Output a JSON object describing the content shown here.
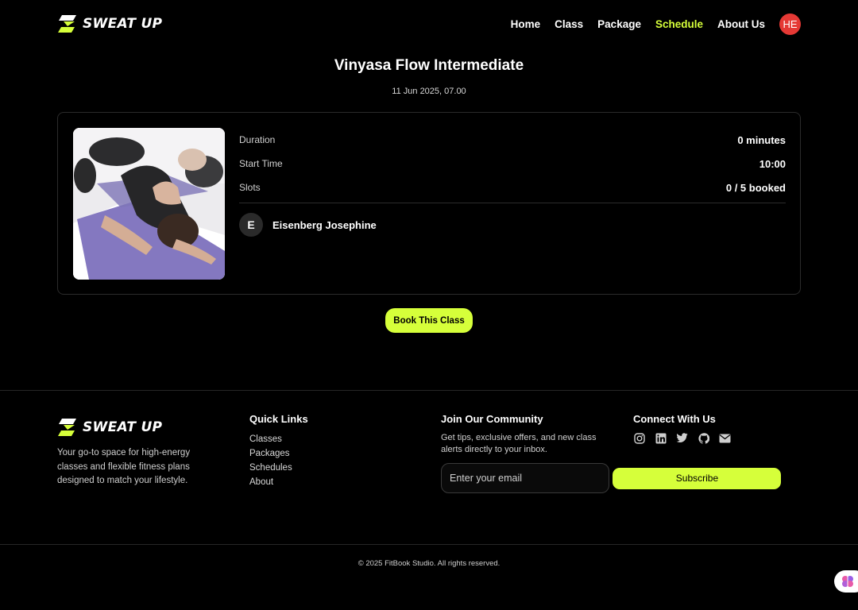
{
  "brand": {
    "name": "SWEAT UP",
    "accent": "#d6ff3a"
  },
  "nav": {
    "items": [
      {
        "label": "Home"
      },
      {
        "label": "Class"
      },
      {
        "label": "Package"
      },
      {
        "label": "Schedule",
        "active": true
      },
      {
        "label": "About Us"
      }
    ],
    "user_initials": "HE",
    "avatar_color": "#e53935"
  },
  "session": {
    "title": "Vinyasa Flow Intermediate",
    "datetime": "11 Jun 2025, 07.00",
    "details": [
      {
        "label": "Duration",
        "value": "0 minutes"
      },
      {
        "label": "Start Time",
        "value": "10:00"
      },
      {
        "label": "Slots",
        "value": "0 / 5 booked"
      }
    ],
    "instructor": {
      "initial": "E",
      "name": "Eisenberg Josephine"
    },
    "book_label": "Book This Class"
  },
  "footer": {
    "description": "Your go-to space for high-energy classes and flexible fitness plans designed to match your lifestyle.",
    "quick_links": {
      "heading": "Quick Links",
      "items": [
        "Classes",
        "Packages",
        "Schedules",
        "About"
      ]
    },
    "community": {
      "heading": "Join Our Community",
      "text": "Get tips, exclusive offers, and new class alerts directly to your inbox.",
      "email_placeholder": "Enter your email",
      "subscribe_label": "Subscribe"
    },
    "connect": {
      "heading": "Connect With Us",
      "icons": [
        "instagram-icon",
        "linkedin-icon",
        "twitter-icon",
        "github-icon",
        "mail-icon"
      ]
    },
    "copyright": "© 2025 FitBook Studio. All rights reserved."
  }
}
